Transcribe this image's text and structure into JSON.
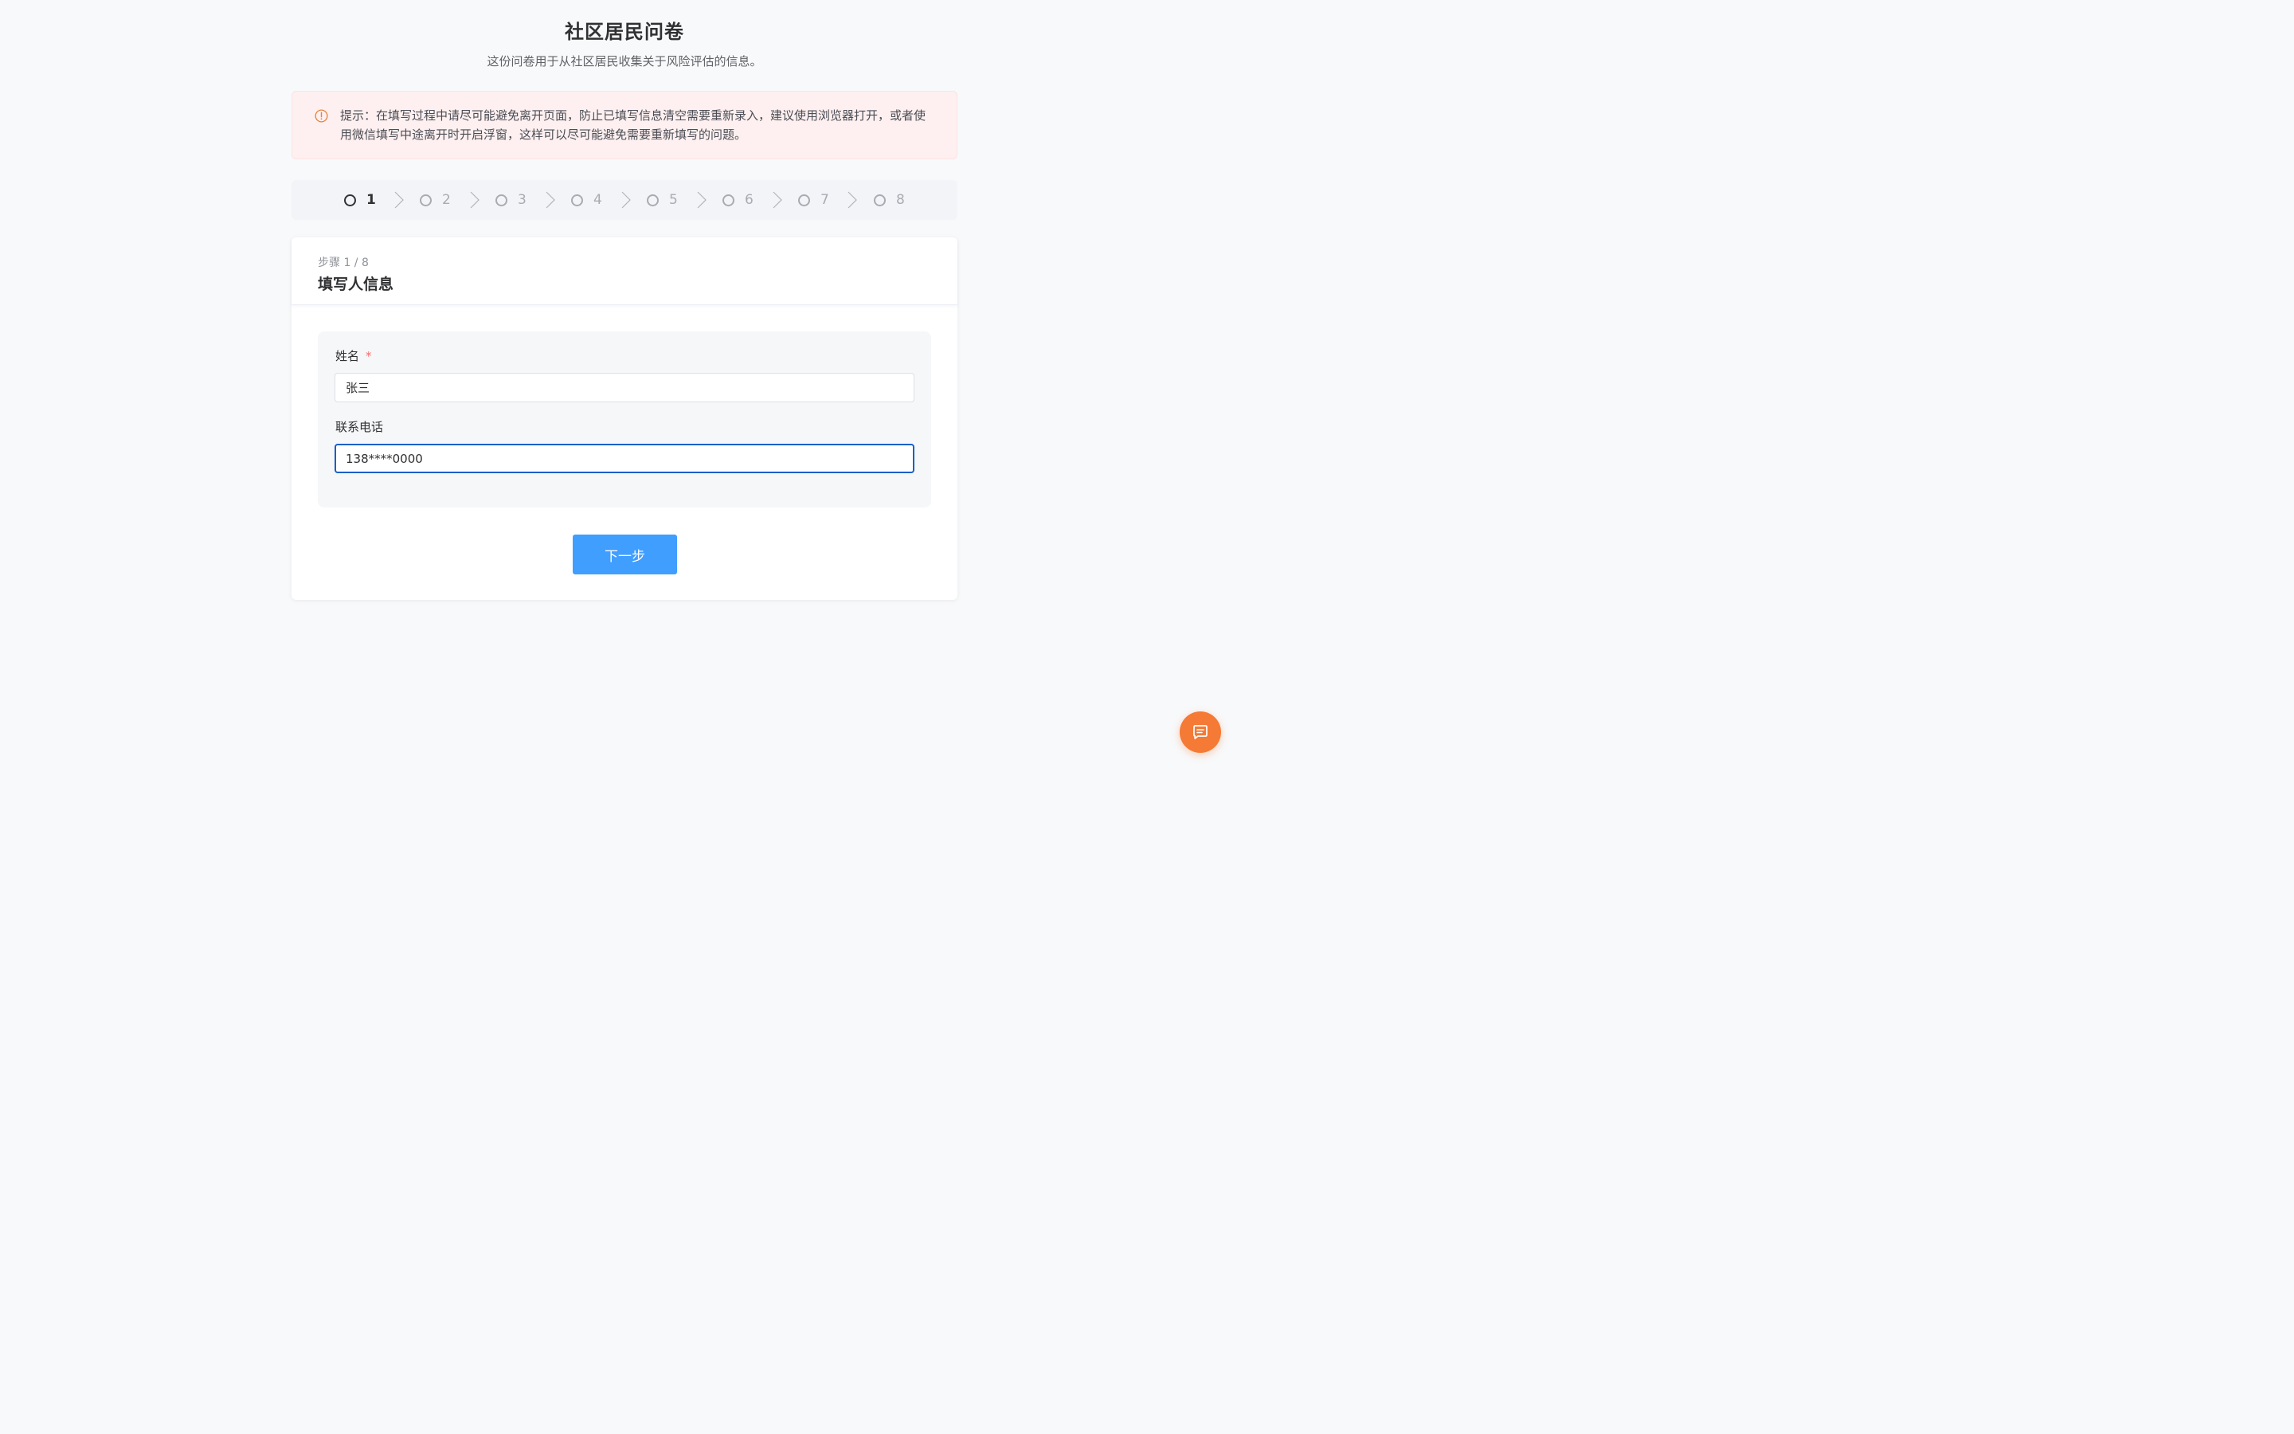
{
  "header": {
    "title": "社区居民问卷",
    "subtitle": "这份问卷用于从社区居民收集关于风险评估的信息。"
  },
  "notice": {
    "icon": "alert-circle-icon",
    "text": "提示：在填写过程中请尽可能避免离开页面，防止已填写信息清空需要重新录入，建议使用浏览器打开，或者使用微信填写中途离开时开启浮窗，这样可以尽可能避免需要重新填写的问题。"
  },
  "steps": {
    "current": 1,
    "items": [
      {
        "label": "1"
      },
      {
        "label": "2"
      },
      {
        "label": "3"
      },
      {
        "label": "4"
      },
      {
        "label": "5"
      },
      {
        "label": "6"
      },
      {
        "label": "7"
      },
      {
        "label": "8"
      }
    ]
  },
  "card": {
    "step_indicator": "步骤 1 / 8",
    "section_title": "填写人信息",
    "fields": {
      "name": {
        "label": "姓名",
        "required_mark": "*",
        "value": "张三"
      },
      "phone": {
        "label": "联系电话",
        "value": "138****0000"
      }
    },
    "next_label": "下一步"
  },
  "fab": {
    "icon": "chat-message-icon"
  },
  "colors": {
    "accent": "#409eff",
    "focus_border": "#1660c8",
    "notice_bg": "#fef0f0",
    "warning_icon": "#e6813b",
    "required": "#f56c6c",
    "fab": "#f47a35"
  }
}
